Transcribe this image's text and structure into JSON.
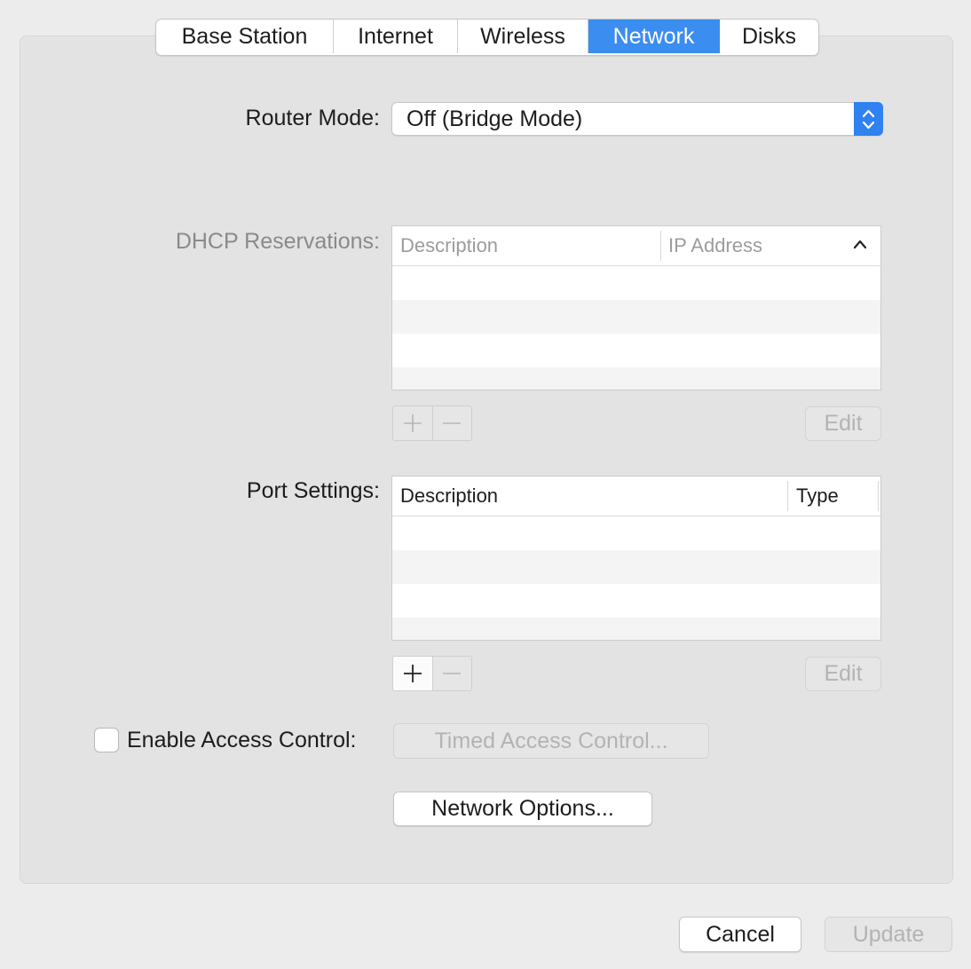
{
  "tabs": [
    {
      "label": "Base Station"
    },
    {
      "label": "Internet"
    },
    {
      "label": "Wireless"
    },
    {
      "label": "Network",
      "active": true
    },
    {
      "label": "Disks"
    }
  ],
  "router_mode": {
    "label": "Router Mode:",
    "value": "Off (Bridge Mode)",
    "icon": "chevron-updown-icon"
  },
  "dhcp": {
    "label": "DHCP Reservations:",
    "columns": [
      "Description",
      "IP Address"
    ],
    "sort_icon": "chevron-up-icon",
    "rows": [],
    "edit_label": "Edit"
  },
  "ports": {
    "label": "Port Settings:",
    "columns": [
      "Description",
      "Type"
    ],
    "rows": [],
    "edit_label": "Edit"
  },
  "access_control": {
    "label": "Enable Access Control:",
    "checked": false,
    "timed_label": "Timed Access Control..."
  },
  "network_options_label": "Network Options...",
  "footer": {
    "cancel_label": "Cancel",
    "update_label": "Update"
  },
  "colors": {
    "accent": "#3b8df0",
    "panel": "#e3e3e3",
    "window": "#ececec"
  }
}
